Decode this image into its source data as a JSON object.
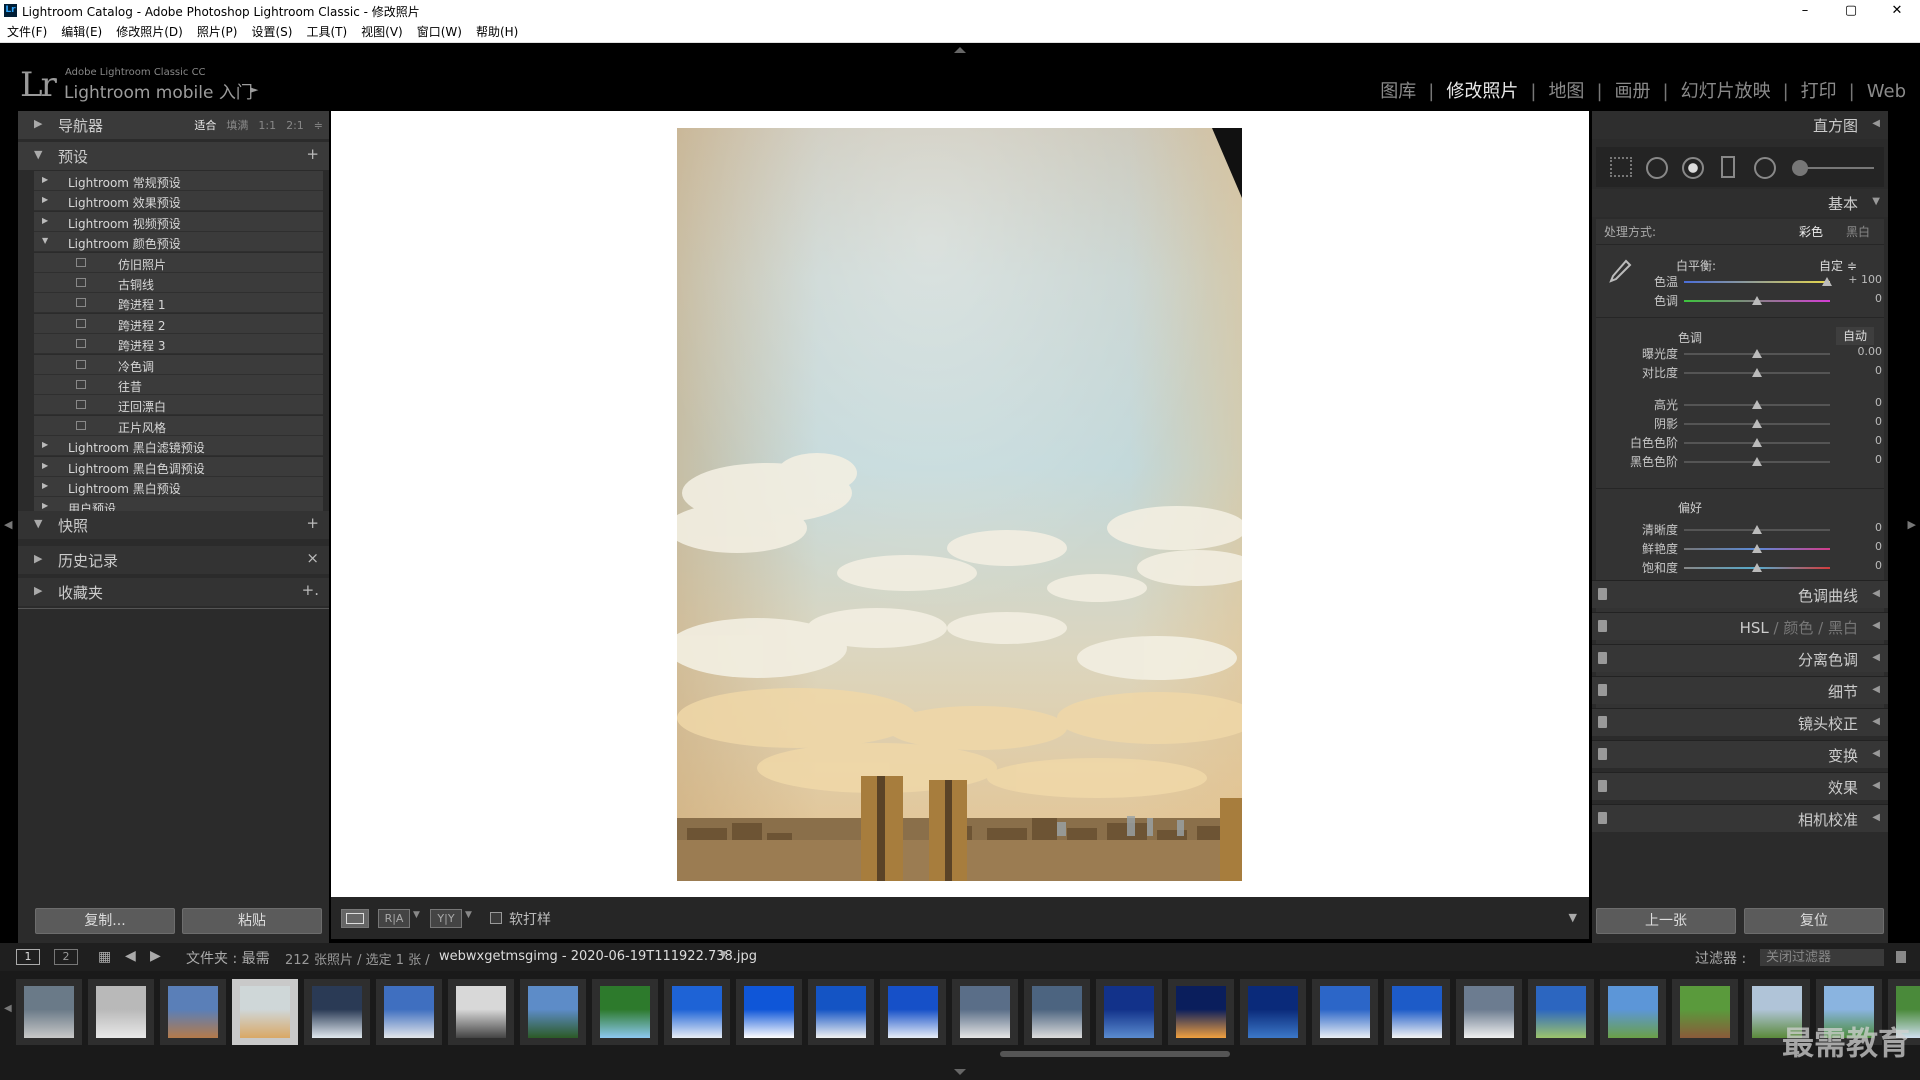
{
  "window": {
    "title": "Lightroom Catalog - Adobe Photoshop Lightroom Classic - 修改照片",
    "minimize": "–",
    "maximize": "▢",
    "close": "✕"
  },
  "menu": [
    "文件(F)",
    "编辑(E)",
    "修改照片(D)",
    "照片(P)",
    "设置(S)",
    "工具(T)",
    "视图(V)",
    "窗口(W)",
    "帮助(H)"
  ],
  "identity": {
    "logo": "Lr",
    "line1": "Adobe Lightroom Classic CC",
    "line2": "Lightroom mobile 入门",
    "arrow": "►"
  },
  "modules": [
    {
      "label": "图库",
      "active": false
    },
    {
      "label": "修改照片",
      "active": true
    },
    {
      "label": "地图",
      "active": false
    },
    {
      "label": "画册",
      "active": false
    },
    {
      "label": "幻灯片放映",
      "active": false
    },
    {
      "label": "打印",
      "active": false
    },
    {
      "label": "Web",
      "active": false
    }
  ],
  "left": {
    "navigator": {
      "title": "导航器",
      "zoom": [
        "适合",
        "填满",
        "1:1",
        "2:1"
      ],
      "zoom_selected": "适合",
      "zoom_arrow": "≑"
    },
    "presets": {
      "title": "预设",
      "add": "+",
      "items": [
        {
          "label": "Lightroom 常规预设",
          "open": false,
          "sub": false
        },
        {
          "label": "Lightroom 效果预设",
          "open": false,
          "sub": false
        },
        {
          "label": "Lightroom 视频预设",
          "open": false,
          "sub": false
        },
        {
          "label": "Lightroom 颜色预设",
          "open": true,
          "sub": false
        },
        {
          "label": "仿旧照片",
          "sub": true
        },
        {
          "label": "古铜线",
          "sub": true
        },
        {
          "label": "跨进程 1",
          "sub": true
        },
        {
          "label": "跨进程 2",
          "sub": true
        },
        {
          "label": "跨进程 3",
          "sub": true
        },
        {
          "label": "冷色调",
          "sub": true
        },
        {
          "label": "往昔",
          "sub": true
        },
        {
          "label": "迂回漂白",
          "sub": true
        },
        {
          "label": "正片风格",
          "sub": true
        },
        {
          "label": "Lightroom 黑白滤镜预设",
          "open": false,
          "sub": false
        },
        {
          "label": "Lightroom 黑白色调预设",
          "open": false,
          "sub": false
        },
        {
          "label": "Lightroom 黑白预设",
          "open": false,
          "sub": false
        },
        {
          "label": "用户预设",
          "open": false,
          "sub": false
        }
      ]
    },
    "snapshots": {
      "title": "快照",
      "add": "+"
    },
    "history": {
      "title": "历史记录",
      "clear": "×"
    },
    "collections": {
      "title": "收藏夹",
      "add": "+."
    },
    "copy_button": "复制...",
    "paste_button": "粘贴"
  },
  "toolbar": {
    "view_icon": "loupe-view-icon",
    "compare1": "R|A",
    "compare2": "Y|Y",
    "softproof": "软打样"
  },
  "right": {
    "histogram": {
      "title": "直方图"
    },
    "basic": {
      "title": "基本",
      "treatment_label": "处理方式:",
      "treatment_color": "彩色",
      "treatment_bw": "黑白",
      "wb_label": "白平衡:",
      "wb_value": "自定 ≑",
      "tone_label": "色调",
      "auto": "自动",
      "presence_label": "偏好",
      "wb_sliders": [
        {
          "name": "色温",
          "value": "+ 100",
          "pos": 0.98
        },
        {
          "name": "色调",
          "value": "0",
          "pos": 0.5
        }
      ],
      "tone_sliders": [
        {
          "name": "曝光度",
          "value": "0.00",
          "pos": 0.5
        },
        {
          "name": "对比度",
          "value": "0",
          "pos": 0.5
        }
      ],
      "tone_sliders2": [
        {
          "name": "高光",
          "value": "0",
          "pos": 0.5
        },
        {
          "name": "阴影",
          "value": "0",
          "pos": 0.5
        },
        {
          "name": "白色色阶",
          "value": "0",
          "pos": 0.5
        },
        {
          "name": "黑色色阶",
          "value": "0",
          "pos": 0.5
        }
      ],
      "presence_sliders": [
        {
          "name": "清晰度",
          "value": "0",
          "pos": 0.5
        },
        {
          "name": "鲜艳度",
          "value": "0",
          "pos": 0.5
        },
        {
          "name": "饱和度",
          "value": "0",
          "pos": 0.5
        }
      ]
    },
    "panels": [
      "色调曲线",
      "HSL / 颜色 / 黑白",
      "分离色调",
      "细节",
      "镜头校正",
      "变换",
      "效果",
      "相机校准"
    ],
    "hsl": {
      "a": "HSL",
      "b": "颜色",
      "c": "黑白"
    },
    "prev_button": "上一张",
    "reset_button": "复位"
  },
  "filmbar": {
    "page1": "1",
    "page2": "2",
    "source": "文件夹 : 最需",
    "count": "212 张照片 / 选定 1 张 /",
    "filename": "webwxgetmsgimg - 2020-06-19T111922.738.jpg",
    "filter_label": "过滤器 :",
    "filter_value": "关闭过滤器"
  },
  "thumbs": [
    {
      "c1": "#6a7a88",
      "c2": "#c8c8c8"
    },
    {
      "c1": "#b9b9b9",
      "c2": "#e8e8e8"
    },
    {
      "c1": "#5a7fb8",
      "c2": "#b47a4a"
    },
    {
      "c1": "#cfd7d8",
      "c2": "#d9a866",
      "sel": true
    },
    {
      "c1": "#2a3a55",
      "c2": "#e0e8ee"
    },
    {
      "c1": "#3f6fc0",
      "c2": "#e3e6ea"
    },
    {
      "c1": "#d8d8d8",
      "c2": "#444"
    },
    {
      "c1": "#5d8cc8",
      "c2": "#2c5a26"
    },
    {
      "c1": "#2d7a2c",
      "c2": "#8dc8f0"
    },
    {
      "c1": "#1e63d6",
      "c2": "#e9eef6"
    },
    {
      "c1": "#0f56d8",
      "c2": "#ffffff"
    },
    {
      "c1": "#1454c4",
      "c2": "#f2f2f2"
    },
    {
      "c1": "#1650c8",
      "c2": "#e8eef8"
    },
    {
      "c1": "#5a6e88",
      "c2": "#e6e6e6"
    },
    {
      "c1": "#4c6480",
      "c2": "#dcdcdc"
    },
    {
      "c1": "#12328a",
      "c2": "#5b8cd0"
    },
    {
      "c1": "#0a1e5c",
      "c2": "#f0a040"
    },
    {
      "c1": "#0a2a7a",
      "c2": "#3c78c8"
    },
    {
      "c1": "#2c66c8",
      "c2": "#e9eef4"
    },
    {
      "c1": "#1d5bc8",
      "c2": "#f4f4f4"
    },
    {
      "c1": "#6c7c90",
      "c2": "#f0f0f0"
    },
    {
      "c1": "#2c66c0",
      "c2": "#9cc46c"
    },
    {
      "c1": "#5c96d8",
      "c2": "#6aa048"
    },
    {
      "c1": "#5a9a3c",
      "c2": "#8a5a3a"
    },
    {
      "c1": "#b0c4d8",
      "c2": "#5a8a3a"
    },
    {
      "c1": "#8ab4e0",
      "c2": "#4c8c3a"
    },
    {
      "c1": "#4a8a3a",
      "c2": "#cfe0f0"
    }
  ],
  "watermark": "最需教育"
}
